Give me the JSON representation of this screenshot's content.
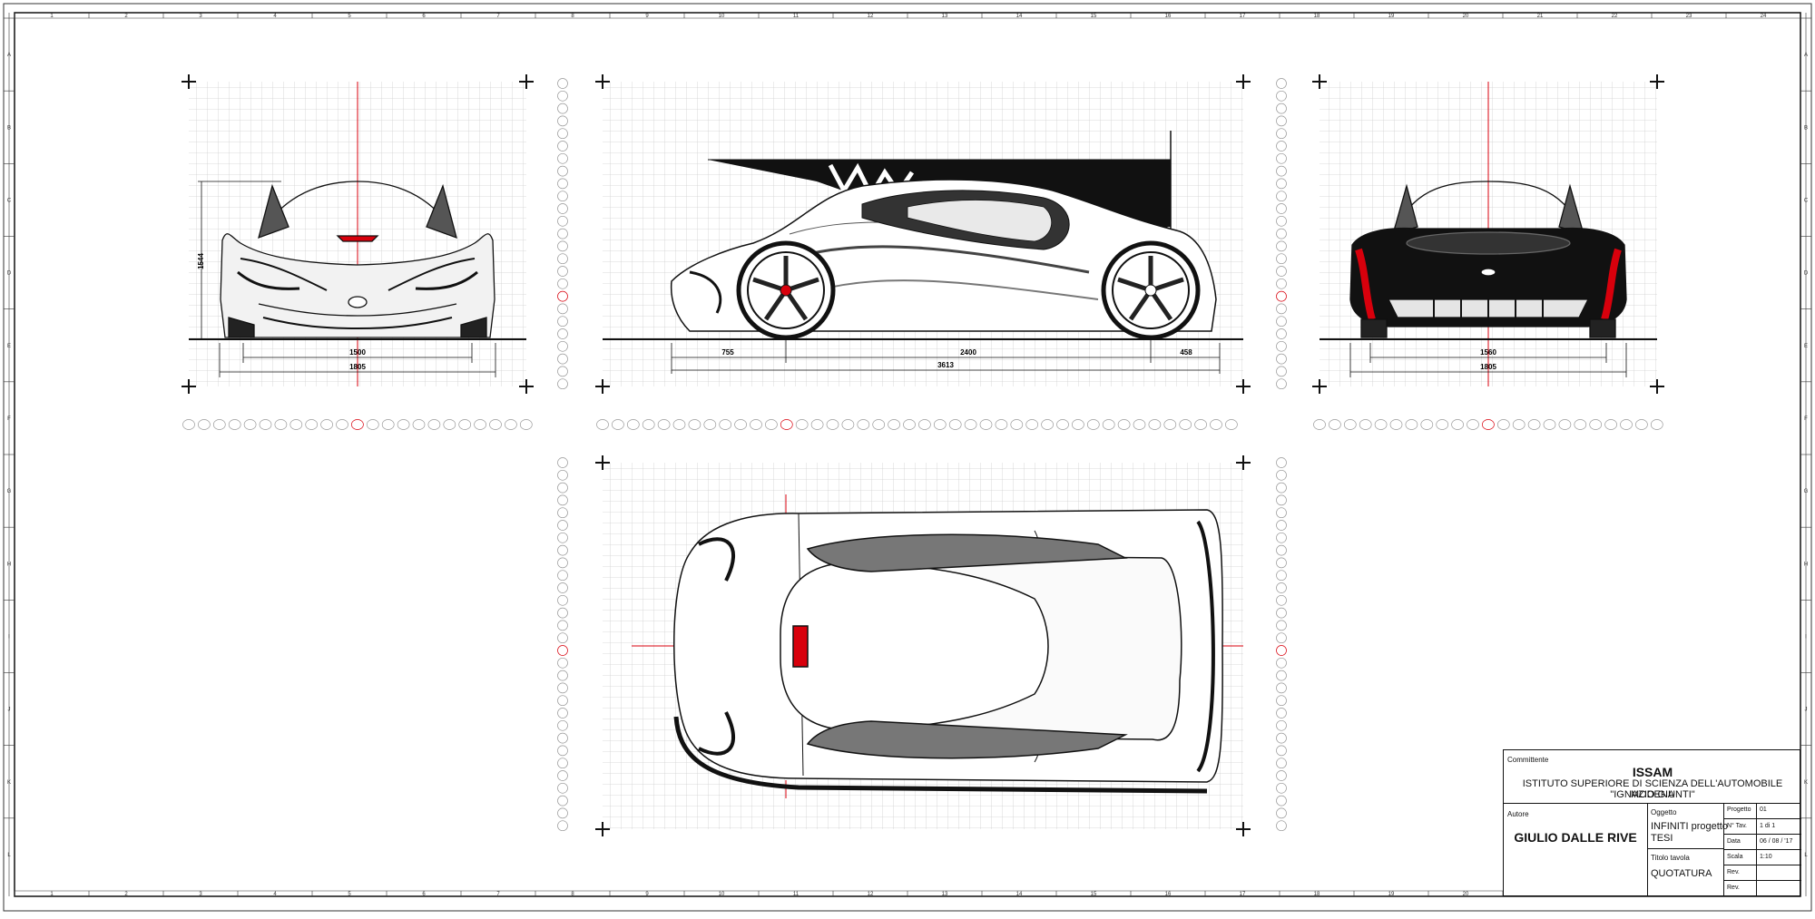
{
  "columns": [
    "1",
    "2",
    "3",
    "4",
    "5",
    "6",
    "7",
    "8",
    "9",
    "10",
    "11",
    "12",
    "13",
    "14",
    "15",
    "16",
    "17",
    "18",
    "19",
    "20",
    "21",
    "22",
    "23",
    "24"
  ],
  "rows": [
    "A",
    "B",
    "C",
    "D",
    "E",
    "F",
    "G",
    "H",
    "I",
    "J",
    "K",
    "L"
  ],
  "front_view": {
    "height_dim": "1544",
    "track_dim": "1500",
    "width_dim": "1805"
  },
  "side_view": {
    "front_overhang_dim": "755",
    "wheelbase_dim": "2400",
    "rear_overhang_dim": "458",
    "length_dim": "3613"
  },
  "rear_view": {
    "track_dim": "1560",
    "width_dim": "1805"
  },
  "colors": {
    "accent_red": "#d8000c",
    "grid": "#c9c9c9",
    "ink": "#111111"
  },
  "title_block": {
    "committente_label": "Committente",
    "org_short": "ISSAM",
    "org_full": "ISTITUTO SUPERIORE DI SCIENZA DELL'AUTOMOBILE MODENA",
    "org_name": "\"IGNAZIO GIUNTI\"",
    "autore_label": "Autore",
    "author": "GIULIO DALLE RIVE",
    "oggetto_label": "Oggetto",
    "oggetto_line1": "INFINITI progetto",
    "oggetto_line2": "TESI",
    "titolo_label": "Titolo tavola",
    "titolo": "QUOTATURA",
    "fields": [
      {
        "label": "Progetto",
        "value": "01"
      },
      {
        "label": "N° Tav.",
        "value": "1 di 1"
      },
      {
        "label": "Data",
        "value": "06 / 08 / '17"
      },
      {
        "label": "Scala",
        "value": "1:10"
      },
      {
        "label": "Rev.",
        "value": ""
      },
      {
        "label": "Rev.",
        "value": ""
      }
    ]
  }
}
